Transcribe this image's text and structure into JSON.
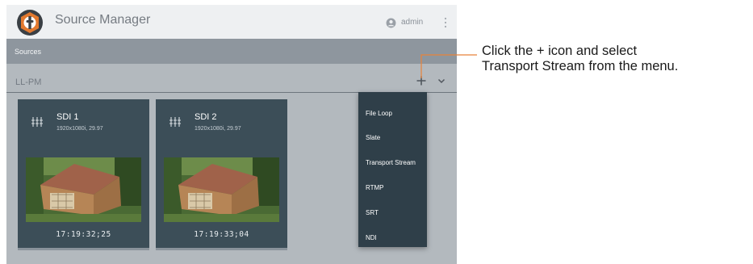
{
  "header": {
    "title": "Source Manager",
    "user": "admin",
    "logo_icon": "app-logo-icon",
    "user_icon": "user-circle-icon",
    "menu_icon": "kebab-menu-icon"
  },
  "sources_bar": {
    "label": "Sources"
  },
  "group": {
    "name": "LL-PM",
    "add_icon": "plus-icon",
    "expand_icon": "chevron-down-icon"
  },
  "cards": [
    {
      "name": "SDI 1",
      "resolution": "1920x1080i, 29.97",
      "timecode": "17:19:32;25",
      "icon": "sdi-connector-icon"
    },
    {
      "name": "SDI 2",
      "resolution": "1920x1080i, 29.97",
      "timecode": "17:19:33;04",
      "icon": "sdi-connector-icon"
    }
  ],
  "add_menu": {
    "items": [
      "File Loop",
      "Slate",
      "Transport Stream",
      "RTMP",
      "SRT",
      "NDI"
    ]
  },
  "callout": {
    "line1": "Click the + icon and select",
    "line2": "Transport Stream from the menu."
  },
  "colors": {
    "header_bg": "#eef0f2",
    "sources_bar_bg": "#8e969e",
    "content_bg": "#b3b9be",
    "card_bg": "#3c4e58",
    "menu_bg": "#2f3f49",
    "callout_line": "#e8823a"
  }
}
